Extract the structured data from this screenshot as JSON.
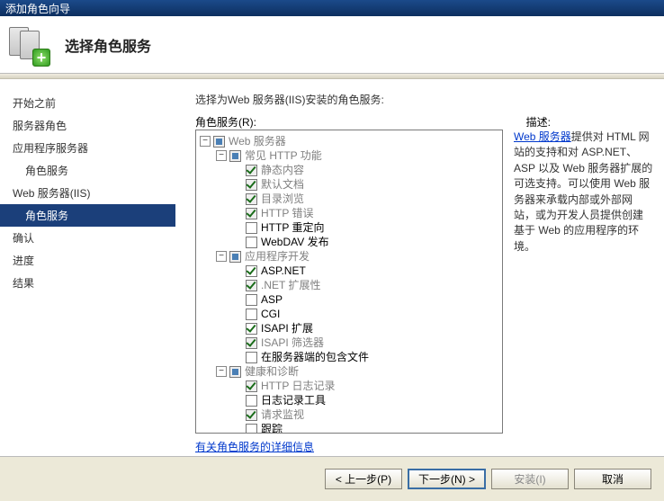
{
  "window": {
    "title": "添加角色向导"
  },
  "header": {
    "title": "选择角色服务"
  },
  "sidebar": {
    "items": [
      {
        "label": "开始之前",
        "indent": 0,
        "active": false
      },
      {
        "label": "服务器角色",
        "indent": 0,
        "active": false
      },
      {
        "label": "应用程序服务器",
        "indent": 0,
        "active": false
      },
      {
        "label": "角色服务",
        "indent": 1,
        "active": false
      },
      {
        "label": "Web 服务器(IIS)",
        "indent": 0,
        "active": false
      },
      {
        "label": "角色服务",
        "indent": 1,
        "active": true
      },
      {
        "label": "确认",
        "indent": 0,
        "active": false
      },
      {
        "label": "进度",
        "indent": 0,
        "active": false
      },
      {
        "label": "结果",
        "indent": 0,
        "active": false
      }
    ]
  },
  "main": {
    "instruction": "选择为Web 服务器(IIS)安装的角色服务:",
    "tree_label": "角色服务(R):",
    "desc_label": "描述:",
    "description_link_text": "Web 服务器",
    "description_rest": "提供对 HTML 网站的支持和对 ASP.NET、ASP 以及 Web 服务器扩展的可选支持。可以使用 Web 服务器来承载内部或外部网站，或为开发人员提供创建基于 Web 的应用程序的环境。",
    "more_info_link": "有关角色服务的详细信息"
  },
  "tree": [
    {
      "depth": 0,
      "exp": "-",
      "state": "partial",
      "dim": true,
      "label": "Web 服务器"
    },
    {
      "depth": 1,
      "exp": "-",
      "state": "partial",
      "dim": true,
      "label": "常见 HTTP 功能"
    },
    {
      "depth": 2,
      "exp": "",
      "state": "checked",
      "dim": true,
      "label": "静态内容"
    },
    {
      "depth": 2,
      "exp": "",
      "state": "checked",
      "dim": true,
      "label": "默认文档"
    },
    {
      "depth": 2,
      "exp": "",
      "state": "checked",
      "dim": true,
      "label": "目录浏览"
    },
    {
      "depth": 2,
      "exp": "",
      "state": "checked",
      "dim": true,
      "label": "HTTP 错误"
    },
    {
      "depth": 2,
      "exp": "",
      "state": "none",
      "dim": false,
      "label": "HTTP 重定向"
    },
    {
      "depth": 2,
      "exp": "",
      "state": "none",
      "dim": false,
      "label": "WebDAV 发布"
    },
    {
      "depth": 1,
      "exp": "-",
      "state": "partial",
      "dim": true,
      "label": "应用程序开发"
    },
    {
      "depth": 2,
      "exp": "",
      "state": "checked",
      "dim": false,
      "label": "ASP.NET"
    },
    {
      "depth": 2,
      "exp": "",
      "state": "checked",
      "dim": true,
      "label": ".NET 扩展性"
    },
    {
      "depth": 2,
      "exp": "",
      "state": "none",
      "dim": false,
      "label": "ASP"
    },
    {
      "depth": 2,
      "exp": "",
      "state": "none",
      "dim": false,
      "label": "CGI"
    },
    {
      "depth": 2,
      "exp": "",
      "state": "checked",
      "dim": false,
      "label": "ISAPI 扩展"
    },
    {
      "depth": 2,
      "exp": "",
      "state": "checked",
      "dim": true,
      "label": "ISAPI 筛选器"
    },
    {
      "depth": 2,
      "exp": "",
      "state": "none",
      "dim": false,
      "label": "在服务器端的包含文件"
    },
    {
      "depth": 1,
      "exp": "-",
      "state": "partial",
      "dim": true,
      "label": "健康和诊断"
    },
    {
      "depth": 2,
      "exp": "",
      "state": "checked",
      "dim": true,
      "label": "HTTP 日志记录"
    },
    {
      "depth": 2,
      "exp": "",
      "state": "none",
      "dim": false,
      "label": "日志记录工具"
    },
    {
      "depth": 2,
      "exp": "",
      "state": "checked",
      "dim": true,
      "label": "请求监视"
    },
    {
      "depth": 2,
      "exp": "",
      "state": "none",
      "dim": false,
      "label": "跟踪"
    }
  ],
  "buttons": {
    "prev": "< 上一步(P)",
    "next": "下一步(N) >",
    "install": "安装(I)",
    "cancel": "取消"
  }
}
